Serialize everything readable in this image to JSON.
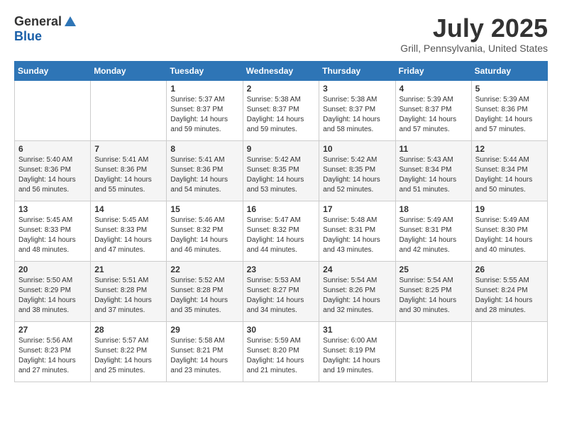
{
  "header": {
    "logo_general": "General",
    "logo_blue": "Blue",
    "month_title": "July 2025",
    "location": "Grill, Pennsylvania, United States"
  },
  "days_of_week": [
    "Sunday",
    "Monday",
    "Tuesday",
    "Wednesday",
    "Thursday",
    "Friday",
    "Saturday"
  ],
  "weeks": [
    {
      "days": [
        {
          "number": "",
          "info": ""
        },
        {
          "number": "",
          "info": ""
        },
        {
          "number": "1",
          "info": "Sunrise: 5:37 AM\nSunset: 8:37 PM\nDaylight: 14 hours and 59 minutes."
        },
        {
          "number": "2",
          "info": "Sunrise: 5:38 AM\nSunset: 8:37 PM\nDaylight: 14 hours and 59 minutes."
        },
        {
          "number": "3",
          "info": "Sunrise: 5:38 AM\nSunset: 8:37 PM\nDaylight: 14 hours and 58 minutes."
        },
        {
          "number": "4",
          "info": "Sunrise: 5:39 AM\nSunset: 8:37 PM\nDaylight: 14 hours and 57 minutes."
        },
        {
          "number": "5",
          "info": "Sunrise: 5:39 AM\nSunset: 8:36 PM\nDaylight: 14 hours and 57 minutes."
        }
      ]
    },
    {
      "days": [
        {
          "number": "6",
          "info": "Sunrise: 5:40 AM\nSunset: 8:36 PM\nDaylight: 14 hours and 56 minutes."
        },
        {
          "number": "7",
          "info": "Sunrise: 5:41 AM\nSunset: 8:36 PM\nDaylight: 14 hours and 55 minutes."
        },
        {
          "number": "8",
          "info": "Sunrise: 5:41 AM\nSunset: 8:36 PM\nDaylight: 14 hours and 54 minutes."
        },
        {
          "number": "9",
          "info": "Sunrise: 5:42 AM\nSunset: 8:35 PM\nDaylight: 14 hours and 53 minutes."
        },
        {
          "number": "10",
          "info": "Sunrise: 5:42 AM\nSunset: 8:35 PM\nDaylight: 14 hours and 52 minutes."
        },
        {
          "number": "11",
          "info": "Sunrise: 5:43 AM\nSunset: 8:34 PM\nDaylight: 14 hours and 51 minutes."
        },
        {
          "number": "12",
          "info": "Sunrise: 5:44 AM\nSunset: 8:34 PM\nDaylight: 14 hours and 50 minutes."
        }
      ]
    },
    {
      "days": [
        {
          "number": "13",
          "info": "Sunrise: 5:45 AM\nSunset: 8:33 PM\nDaylight: 14 hours and 48 minutes."
        },
        {
          "number": "14",
          "info": "Sunrise: 5:45 AM\nSunset: 8:33 PM\nDaylight: 14 hours and 47 minutes."
        },
        {
          "number": "15",
          "info": "Sunrise: 5:46 AM\nSunset: 8:32 PM\nDaylight: 14 hours and 46 minutes."
        },
        {
          "number": "16",
          "info": "Sunrise: 5:47 AM\nSunset: 8:32 PM\nDaylight: 14 hours and 44 minutes."
        },
        {
          "number": "17",
          "info": "Sunrise: 5:48 AM\nSunset: 8:31 PM\nDaylight: 14 hours and 43 minutes."
        },
        {
          "number": "18",
          "info": "Sunrise: 5:49 AM\nSunset: 8:31 PM\nDaylight: 14 hours and 42 minutes."
        },
        {
          "number": "19",
          "info": "Sunrise: 5:49 AM\nSunset: 8:30 PM\nDaylight: 14 hours and 40 minutes."
        }
      ]
    },
    {
      "days": [
        {
          "number": "20",
          "info": "Sunrise: 5:50 AM\nSunset: 8:29 PM\nDaylight: 14 hours and 38 minutes."
        },
        {
          "number": "21",
          "info": "Sunrise: 5:51 AM\nSunset: 8:28 PM\nDaylight: 14 hours and 37 minutes."
        },
        {
          "number": "22",
          "info": "Sunrise: 5:52 AM\nSunset: 8:28 PM\nDaylight: 14 hours and 35 minutes."
        },
        {
          "number": "23",
          "info": "Sunrise: 5:53 AM\nSunset: 8:27 PM\nDaylight: 14 hours and 34 minutes."
        },
        {
          "number": "24",
          "info": "Sunrise: 5:54 AM\nSunset: 8:26 PM\nDaylight: 14 hours and 32 minutes."
        },
        {
          "number": "25",
          "info": "Sunrise: 5:54 AM\nSunset: 8:25 PM\nDaylight: 14 hours and 30 minutes."
        },
        {
          "number": "26",
          "info": "Sunrise: 5:55 AM\nSunset: 8:24 PM\nDaylight: 14 hours and 28 minutes."
        }
      ]
    },
    {
      "days": [
        {
          "number": "27",
          "info": "Sunrise: 5:56 AM\nSunset: 8:23 PM\nDaylight: 14 hours and 27 minutes."
        },
        {
          "number": "28",
          "info": "Sunrise: 5:57 AM\nSunset: 8:22 PM\nDaylight: 14 hours and 25 minutes."
        },
        {
          "number": "29",
          "info": "Sunrise: 5:58 AM\nSunset: 8:21 PM\nDaylight: 14 hours and 23 minutes."
        },
        {
          "number": "30",
          "info": "Sunrise: 5:59 AM\nSunset: 8:20 PM\nDaylight: 14 hours and 21 minutes."
        },
        {
          "number": "31",
          "info": "Sunrise: 6:00 AM\nSunset: 8:19 PM\nDaylight: 14 hours and 19 minutes."
        },
        {
          "number": "",
          "info": ""
        },
        {
          "number": "",
          "info": ""
        }
      ]
    }
  ]
}
